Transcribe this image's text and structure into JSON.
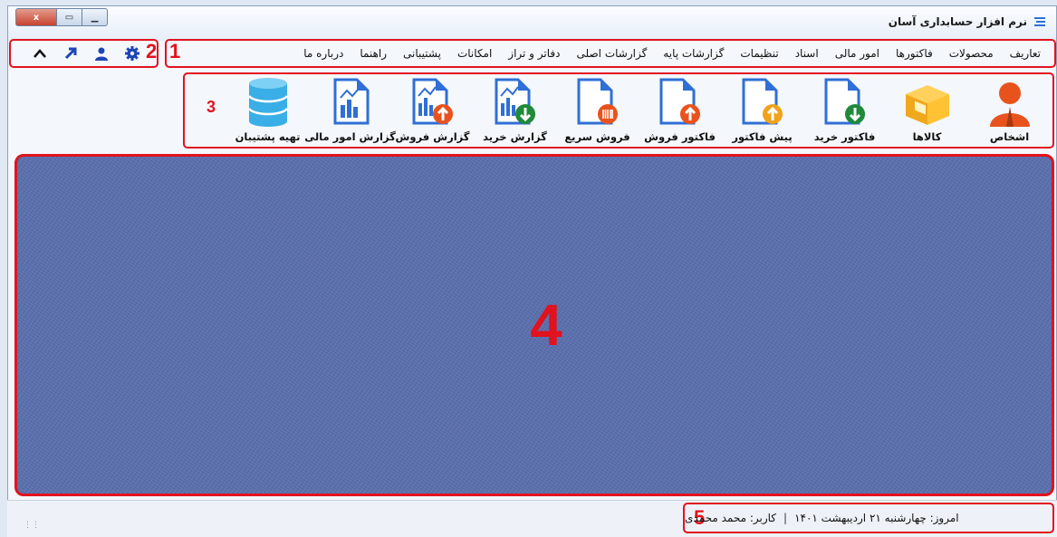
{
  "window": {
    "title": "نرم افزار حسابداری آسان",
    "buttons": {
      "close": "x",
      "restore": "▭",
      "minimize": "▁"
    }
  },
  "menu": {
    "items": [
      "تعاریف",
      "محصولات",
      "فاکتورها",
      "امور مالی",
      "اسناد",
      "تنظیمات",
      "گزارشات پایه",
      "گزارشات اصلی",
      "دفاتر و تراز",
      "امکانات",
      "پشتیبانی",
      "راهنما",
      "درباره ما"
    ]
  },
  "toolbar_icons": [
    "settings-icon",
    "user-icon",
    "arrow-up-right-icon",
    "chevron-up-icon"
  ],
  "ribbon": {
    "buttons": [
      {
        "label": "اشخاص",
        "icon": "person-icon"
      },
      {
        "label": "کالاها",
        "icon": "box-icon"
      },
      {
        "label": "فاکتور خرید",
        "icon": "doc-download-icon"
      },
      {
        "label": "پیش فاکتور",
        "icon": "doc-upload-orange-icon"
      },
      {
        "label": "فاکتور فروش",
        "icon": "doc-upload-red-icon"
      },
      {
        "label": "فروش سریع",
        "icon": "doc-barcode-icon"
      },
      {
        "label": "گزارش خرید",
        "icon": "report-down-icon"
      },
      {
        "label": "گزارش فروش",
        "icon": "report-up-icon"
      },
      {
        "label": "گزارش امور مالی",
        "icon": "report-chart-icon"
      },
      {
        "label": "تهیه پشتیبان",
        "icon": "database-icon"
      }
    ]
  },
  "callouts": {
    "menu": "1",
    "tools": "2",
    "ribbon": "3",
    "main": "4",
    "status": "5"
  },
  "status": {
    "date": "امروز: چهارشنبه ۲۱ اردیبهشت ۱۴۰۱",
    "separator": "|",
    "user": "کاربر: محمد محمدی"
  },
  "colors": {
    "accent": "#e2121f",
    "icon_blue": "#2f6fd6",
    "icon_orange": "#f0941c",
    "main_bg": "#5a6fac"
  }
}
